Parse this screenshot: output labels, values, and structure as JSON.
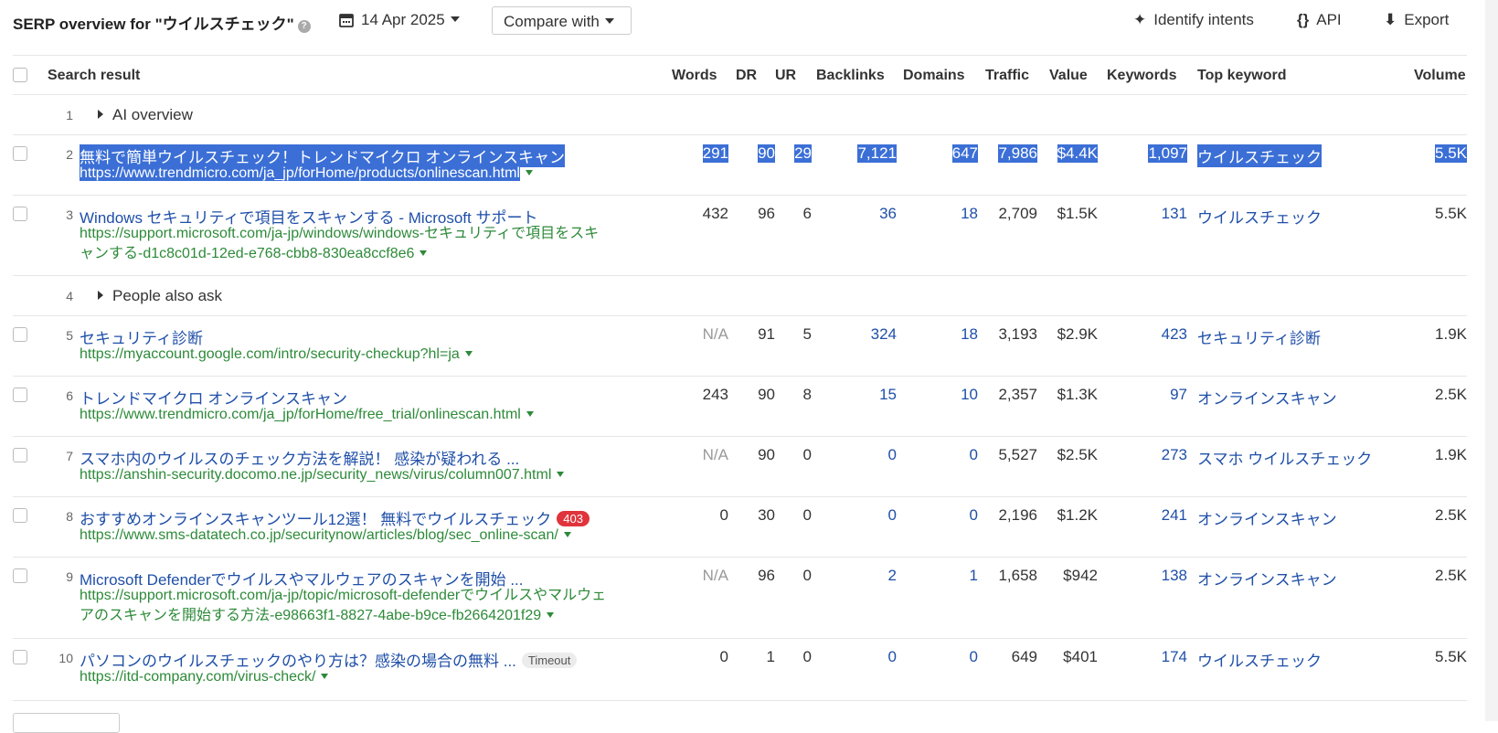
{
  "header": {
    "title": "SERP overview for \"ウイルスチェック\"",
    "date": "14 Apr 2025",
    "compare": "Compare with",
    "identify_intents": "Identify intents",
    "api": "API",
    "export": "Export"
  },
  "columns": {
    "search_result": "Search result",
    "words": "Words",
    "dr": "DR",
    "ur": "UR",
    "backlinks": "Backlinks",
    "domains": "Domains",
    "traffic": "Traffic",
    "value": "Value",
    "keywords": "Keywords",
    "top_keyword": "Top keyword",
    "volume": "Volume"
  },
  "groups": {
    "ai": {
      "num": "1",
      "label": "AI overview"
    },
    "paa": {
      "num": "4",
      "label": "People also ask"
    }
  },
  "rows": [
    {
      "num": "2",
      "title": "無料で簡単ウイルスチェック！トレンドマイクロ オンラインスキャン",
      "url": "https://www.trendmicro.com/ja_jp/forHome/products/onlinescan.html",
      "words": "291",
      "dr": "90",
      "ur": "29",
      "backlinks": "7,121",
      "domains": "647",
      "traffic": "7,986",
      "value": "$4.4K",
      "keywords": "1,097",
      "top_keyword": "ウイルスチェック",
      "volume": "5.5K"
    },
    {
      "num": "3",
      "title": "Windows セキュリティで項目をスキャンする - Microsoft サポート",
      "url_line1": "https://support.microsoft.com/ja-jp/windows/windows-セキュリティで項目をスキ",
      "url_line2": "ャンする-d1c8c01d-12ed-e768-cbb8-830ea8ccf8e6",
      "words": "432",
      "dr": "96",
      "ur": "6",
      "backlinks": "36",
      "domains": "18",
      "traffic": "2,709",
      "value": "$1.5K",
      "keywords": "131",
      "top_keyword": "ウイルスチェック",
      "volume": "5.5K"
    },
    {
      "num": "5",
      "title": "セキュリティ診断",
      "url": "https://myaccount.google.com/intro/security-checkup?hl=ja",
      "words": "N/A",
      "dr": "91",
      "ur": "5",
      "backlinks": "324",
      "domains": "18",
      "traffic": "3,193",
      "value": "$2.9K",
      "keywords": "423",
      "top_keyword": "セキュリティ診断",
      "volume": "1.9K"
    },
    {
      "num": "6",
      "title": "トレンドマイクロ オンラインスキャン",
      "url": "https://www.trendmicro.com/ja_jp/forHome/free_trial/onlinescan.html",
      "words": "243",
      "dr": "90",
      "ur": "8",
      "backlinks": "15",
      "domains": "10",
      "traffic": "2,357",
      "value": "$1.3K",
      "keywords": "97",
      "top_keyword": "オンラインスキャン",
      "volume": "2.5K"
    },
    {
      "num": "7",
      "title": "スマホ内のウイルスのチェック方法を解説！ 感染が疑われる ...",
      "url": "https://anshin-security.docomo.ne.jp/security_news/virus/column007.html",
      "words": "N/A",
      "dr": "90",
      "ur": "0",
      "backlinks": "0",
      "domains": "0",
      "traffic": "5,527",
      "value": "$2.5K",
      "keywords": "273",
      "top_keyword": "スマホ ウイルスチェック",
      "volume": "1.9K"
    },
    {
      "num": "8",
      "title": "おすすめオンラインスキャンツール12選！ 無料でウイルスチェック",
      "badge": "403",
      "url": "https://www.sms-datatech.co.jp/securitynow/articles/blog/sec_online-scan/",
      "words": "0",
      "dr": "30",
      "ur": "0",
      "backlinks": "0",
      "domains": "0",
      "traffic": "2,196",
      "value": "$1.2K",
      "keywords": "241",
      "top_keyword": "オンラインスキャン",
      "volume": "2.5K"
    },
    {
      "num": "9",
      "title": "Microsoft Defenderでウイルスやマルウェアのスキャンを開始 ...",
      "url_line1": "https://support.microsoft.com/ja-jp/topic/microsoft-defenderでウイルスやマルウェ",
      "url_line2": "アのスキャンを開始する方法-e98663f1-8827-4abe-b9ce-fb2664201f29",
      "words": "N/A",
      "dr": "96",
      "ur": "0",
      "backlinks": "2",
      "domains": "1",
      "traffic": "1,658",
      "value": "$942",
      "keywords": "138",
      "top_keyword": "オンラインスキャン",
      "volume": "2.5K"
    },
    {
      "num": "10",
      "title": "パソコンのウイルスチェックのやり方は？感染の場合の無料 ...",
      "badge": "Timeout",
      "url": "https://itd-company.com/virus-check/",
      "words": "0",
      "dr": "1",
      "ur": "0",
      "backlinks": "0",
      "domains": "0",
      "traffic": "649",
      "value": "$401",
      "keywords": "174",
      "top_keyword": "ウイルスチェック",
      "volume": "5.5K"
    }
  ]
}
